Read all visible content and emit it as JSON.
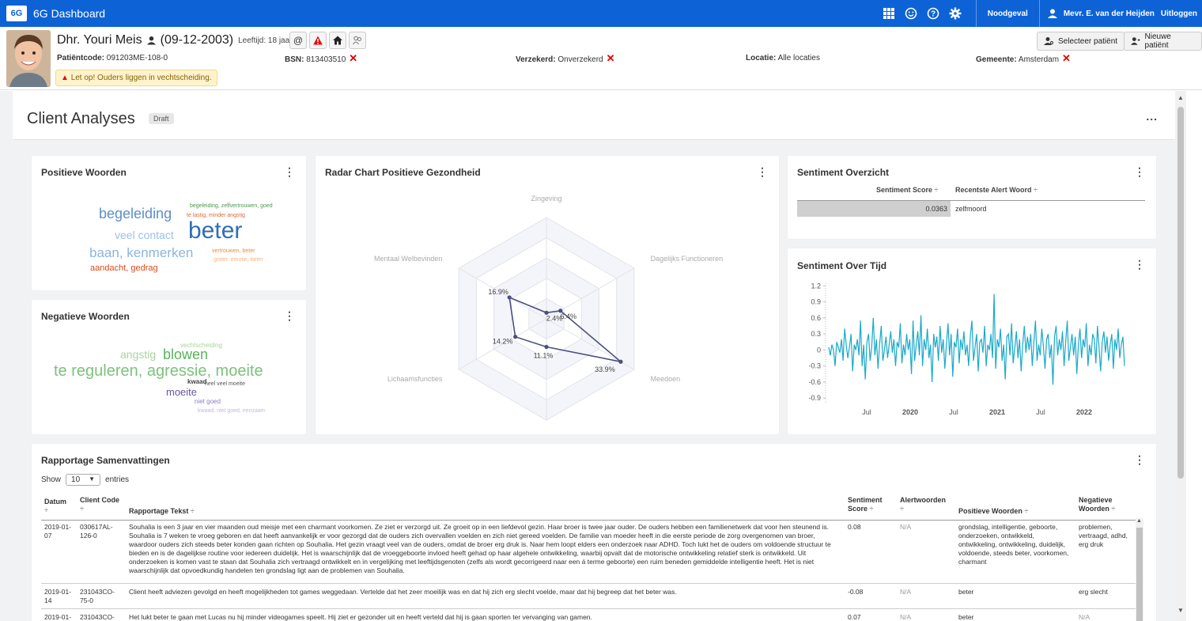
{
  "topbar": {
    "logo": "6G",
    "title": "6G Dashboard",
    "icons": [
      "grid-icon",
      "smile-icon",
      "help-icon",
      "gear-icon"
    ],
    "emergency": "Noodgeval",
    "user": "Mevr. E. van der Heijden",
    "logout": "Uitloggen"
  },
  "patient": {
    "name": "Dhr. Youri Meis",
    "dob": "(09-12-2003)",
    "age": "Leeftijd: 18 jaar",
    "code_label": "Patiëntcode:",
    "code": "091203ME-108-0",
    "bsn_label": "BSN:",
    "bsn": "813403510",
    "insured_label": "Verzekerd:",
    "insured": "Onverzekerd",
    "location_label": "Locatie:",
    "location": "Alle locaties",
    "municipality_label": "Gemeente:",
    "municipality": "Amsterdam",
    "warning": "Let op! Ouders liggen in vechtscheiding.",
    "select_patient": "Selecteer patiënt",
    "new_patient": "Nieuwe patiënt"
  },
  "page": {
    "title": "Client Analyses",
    "badge": "Draft",
    "menu": "..."
  },
  "positive": {
    "title": "Positieve Woorden",
    "menu": "⋮",
    "words": [
      "begeleiding",
      "begeleiding, zelfvertrouwen, goed",
      "te lastig, minder angstig",
      "veel contact",
      "beter",
      "baan, kenmerken",
      "vertrouwen, beter",
      "groter, emotie, beter",
      "aandacht, gedrag"
    ]
  },
  "negative": {
    "title": "Negatieve Woorden",
    "menu": "⋮",
    "words": [
      "vechtscheiding",
      "angstig",
      "blowen",
      "te reguleren, agressie, moeite",
      "kwaad",
      "heel veel moeite",
      "moeite",
      "niet goed",
      "kwaad, niet goed, eenzaam"
    ]
  },
  "radar": {
    "title": "Radar Chart Positieve Gezondheid",
    "menu": "⋮"
  },
  "sentiment_summary": {
    "title": "Sentiment Overzicht",
    "menu": "⋮",
    "col_score": "Sentiment Score",
    "col_word": "Recentste Alert Woord",
    "score": "0.0363",
    "word": "zelfmoord",
    "sort_icon": "÷"
  },
  "timeline": {
    "title": "Sentiment Over Tijd",
    "menu": "⋮"
  },
  "report": {
    "title": "Rapportage Samenvattingen",
    "menu": "⋮",
    "show": "Show",
    "entries": "entries",
    "page_size": "10",
    "columns": [
      "Datum",
      "Client Code",
      "Rapportage Tekst",
      "Sentiment Score",
      "Alertwoorden",
      "Positieve Woorden",
      "Negatieve Woorden"
    ],
    "rows": [
      {
        "date": "2019-01-07",
        "code": "030617AL-126-0",
        "text": "Souhalia is een 3 jaar en vier maanden oud meisje met een charmant voorkomen. Ze ziet er verzorgd uit. Ze groeit op in een liefdevol gezin. Haar broer is twee jaar ouder. De ouders hebben een familienetwerk dat voor hen steunend is. Souhalia is 7 weken te vroeg geboren en dat heeft aanvankelijk er voor gezorgd dat de ouders zich overvallen voelden en zich niet gereed voelden. De familie van moeder heeft in die eerste periode de zorg overgenomen van broer, waardoor ouders zich steeds beter konden gaan richten op Souhalia. Het gezin vraagt veel van de ouders, omdat de broer erg druk is. Naar hem loopt elders een onderzoek naar ADHD. Toch lukt het de ouders om voldoende structuur te bieden en is de dagelijkse routine voor iedereen duidelijk. Het is waarschijnlijk dat de vroeggeboorte invloed heeft gehad op haar algehele ontwikkeling, waarbij opvalt dat de motorische ontwikkeling relatief sterk is ontwikkeld. Uit onderzoeken is komen vast te staan dat Souhalia zich vertraagd ontwikkelt en in vergelijking met leeftijdsgenoten (zelfs als wordt gecorrigeerd naar een á terme geboorte) een ruim beneden gemiddelde intelligentie heeft. Het is niet waarschijnlijk dat opvoedkundig handelen ten grondslag ligt aan de problemen van Souhalia.",
        "score": "0.08",
        "alert": "N/A",
        "pos": "grondslag, intelligentie, geboorte, onderzoeken, ontwikkeld, ontwikkeling, ontwikkeling, duidelijk, voldoende, steeds beter, voorkomen, charmant",
        "neg": "problemen, vertraagd, adhd, erg druk"
      },
      {
        "date": "2019-01-14",
        "code": "231043CO-75-0",
        "text": "Client heeft adviezen gevolgd en heeft mogelijkheden tot games weggedaan. Vertelde dat het zeer moeilijk was en dat hij zich erg slecht voelde, maar dat hij begreep dat het beter was.",
        "score": "-0.08",
        "alert": "N/A",
        "pos": "beter",
        "neg": "erg slecht"
      },
      {
        "date": "2019-01-",
        "code": "231043CO-",
        "text": "Het lukt beter te gaan met Lucas nu hij minder videogames speelt. Hij ziet er gezonder uit en heeft verteld dat hij is gaan sporten ter vervanging van gamen.",
        "score": "0.07",
        "alert": "N/A",
        "pos": "beter",
        "neg": "N/A"
      }
    ]
  },
  "chart_data": [
    {
      "type": "radar",
      "title": "Radar Chart Positieve Gezondheid",
      "categories": [
        "Zingeving",
        "Dagelijks Functioneren",
        "Meedoen",
        "Kwaliteit van Leven",
        "Lichaamsfuncties",
        "Mentaal Welbevinden"
      ],
      "values": [
        2.4,
        6.4,
        33.9,
        11.1,
        14.2,
        16.9
      ],
      "labels": [
        "2.4%",
        "6.4%",
        "33.9%",
        "11.1%",
        "14.2%",
        "16.9%"
      ],
      "max": 40,
      "color": "#4a4f7e"
    },
    {
      "type": "line",
      "title": "Sentiment Over Tijd",
      "yticks": [
        "1.2",
        "0.9",
        "0.6",
        "0.3",
        "0",
        "-0.3",
        "-0.6",
        "-0.9"
      ],
      "ylim": [
        -1.0,
        1.25
      ],
      "xticks": [
        "Jul",
        "2020",
        "Jul",
        "2021",
        "Jul",
        "2022"
      ],
      "xrange": [
        "2019-01",
        "2022-12"
      ],
      "color": "#1aa9c9",
      "values": [
        0.05,
        -0.1,
        0.1,
        0.0,
        -0.3,
        0.15,
        0.05,
        -0.05,
        0.2,
        -0.2,
        0.4,
        0.1,
        -0.15,
        0.05,
        0.3,
        -0.4,
        0.1,
        0.0,
        0.2,
        -0.1,
        0.55,
        -0.3,
        0.1,
        -0.55,
        0.15,
        0.3,
        -0.2,
        0.05,
        0.6,
        -0.1,
        0.2,
        -0.35,
        0.1,
        0.45,
        -0.2,
        0.0,
        0.25,
        -0.15,
        0.1,
        0.35,
        -0.05,
        0.2,
        -0.3,
        0.15,
        0.05,
        0.5,
        -0.25,
        0.1,
        -0.1,
        0.3,
        0.0,
        0.2,
        -0.45,
        0.55,
        -0.2,
        0.1,
        0.35,
        -0.1,
        0.65,
        -0.3,
        0.2,
        0.0,
        0.4,
        -0.15,
        0.1,
        -0.6,
        0.3,
        0.05,
        0.25,
        -0.2,
        0.45,
        -0.05,
        0.2,
        -0.35,
        0.1,
        0.5,
        -0.1,
        0.3,
        -0.5,
        0.15,
        0.05,
        0.4,
        -0.25,
        0.2,
        0.0,
        0.35,
        -0.1,
        0.1,
        -0.3,
        0.25,
        0.55,
        -0.2,
        0.05,
        0.3,
        -0.4,
        0.15,
        0.2,
        -0.05,
        0.45,
        -0.3,
        0.1,
        0.0,
        0.3,
        -0.15,
        1.05,
        -0.35,
        0.2,
        0.05,
        0.4,
        -0.2,
        0.1,
        -0.55,
        0.25,
        0.3,
        -0.1,
        0.5,
        -0.25,
        0.05,
        0.35,
        -0.15,
        0.2,
        -0.4,
        0.1,
        0.45,
        -0.05,
        0.25,
        0.0,
        0.3,
        -0.3,
        0.15,
        0.55,
        -0.2,
        0.1,
        -0.1,
        0.4,
        0.05,
        -0.35,
        0.2,
        0.3,
        -0.15,
        0.1,
        -0.65,
        0.25,
        0.45,
        -0.1,
        0.2,
        0.0,
        0.35,
        -0.3,
        0.15,
        0.55,
        -0.2,
        0.05,
        0.3,
        -0.1,
        0.25,
        -0.45,
        0.1,
        0.4,
        -0.15,
        0.2,
        0.05,
        0.5,
        -0.3,
        0.1,
        -0.1,
        0.3,
        0.2,
        -0.25,
        0.45,
        0.05,
        -0.4,
        0.15,
        0.35,
        -0.05,
        0.25,
        -0.2,
        0.1,
        0.3,
        -0.35,
        0.2,
        0.0,
        0.4,
        -0.15,
        0.1,
        0.25,
        -0.3
      ]
    }
  ]
}
